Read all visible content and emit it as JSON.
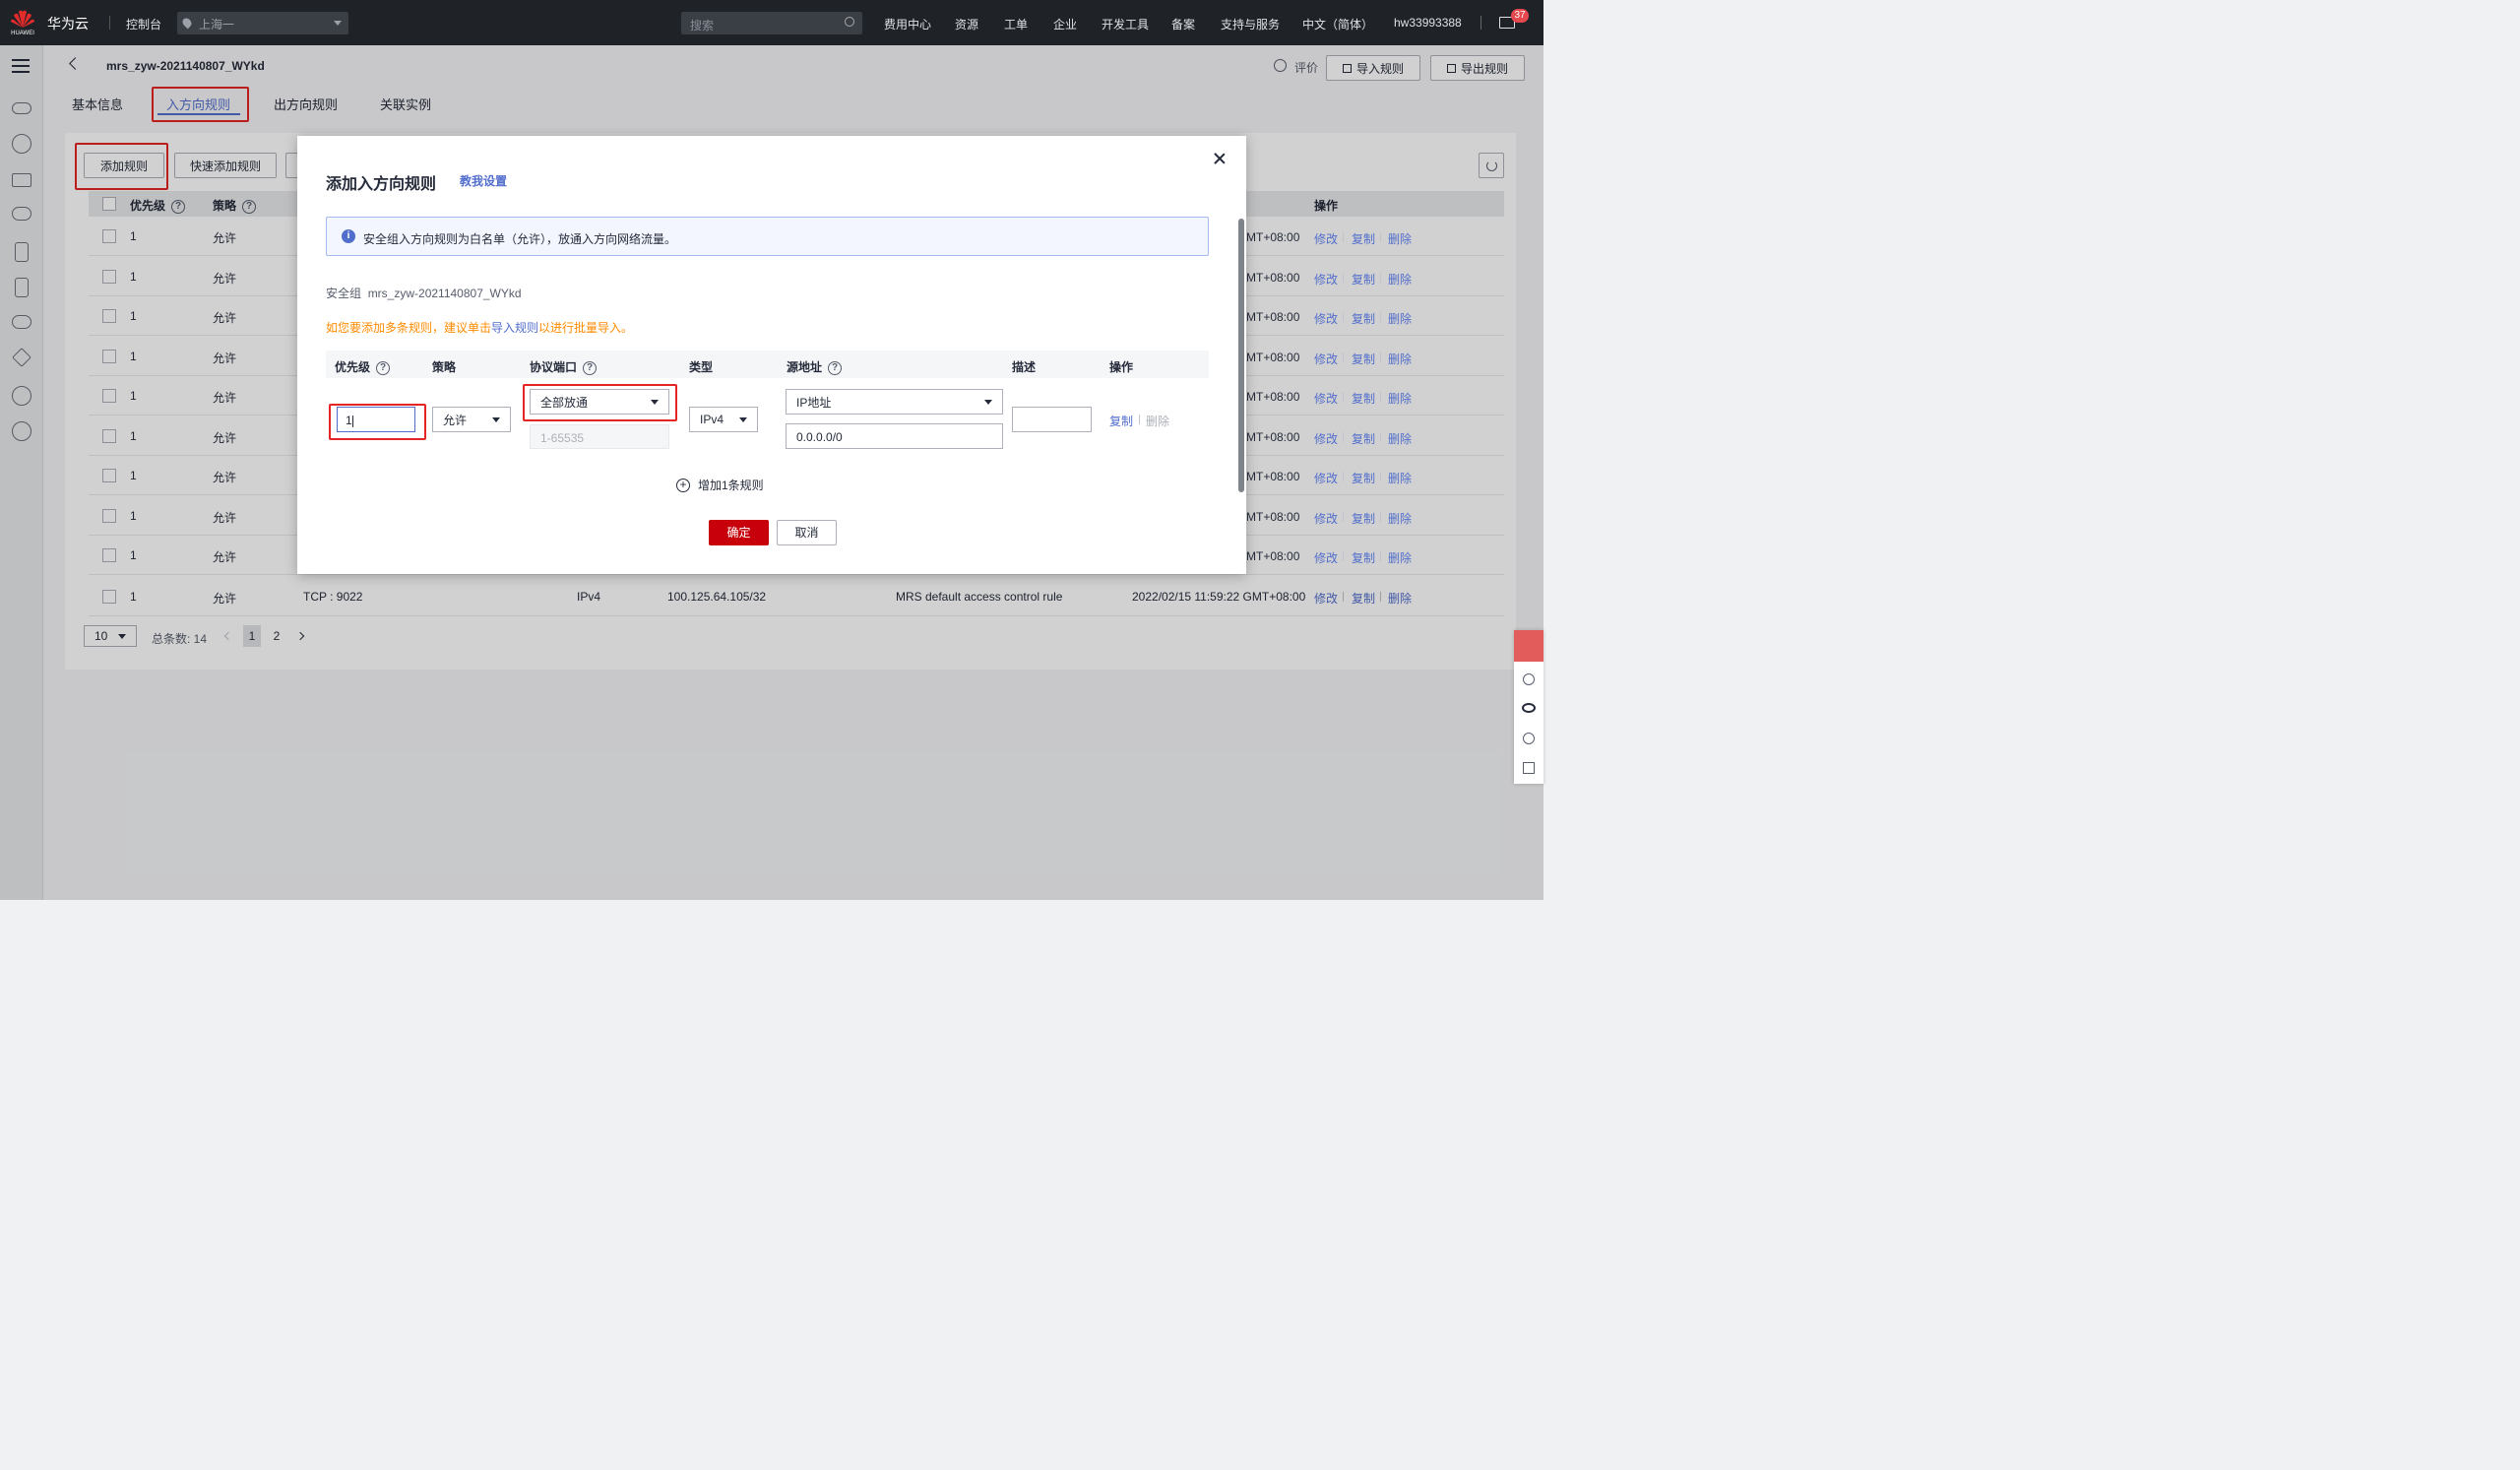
{
  "topnav": {
    "brand": "华为云",
    "logo_text": "HUAWEI",
    "console": "控制台",
    "region": "上海一",
    "search_placeholder": "搜索",
    "menu": [
      "费用中心",
      "资源",
      "工单",
      "企业",
      "开发工具",
      "备案",
      "支持与服务",
      "中文（简体）"
    ],
    "user": "hw33993388",
    "mail_badge": "37"
  },
  "page": {
    "back_title": "mrs_zyw-2021140807_WYkd",
    "feedback": "评价",
    "import_btn": "导入规则",
    "export_btn": "导出规则",
    "tabs": [
      "基本信息",
      "入方向规则",
      "出方向规则",
      "关联实例"
    ],
    "add_rule": "添加规则",
    "quick_add": "快速添加规则"
  },
  "table": {
    "headers": {
      "priority": "优先级",
      "strategy": "策略",
      "operation": "操作"
    },
    "row_priority": "1",
    "row_strategy": "允许",
    "row_time_suffix": "MT+08:00",
    "actions": [
      "修改",
      "复制",
      "删除"
    ],
    "last_row": {
      "priority": "1",
      "strategy": "允许",
      "port": "TCP : 9022",
      "type": "IPv4",
      "source": "100.125.64.105/32",
      "desc": "MRS default access control rule",
      "time": "2022/02/15 11:59:22 GMT+08:00"
    },
    "row_count": 10
  },
  "pager": {
    "size": "10",
    "total": "总条数: 14",
    "pages": [
      "1",
      "2"
    ]
  },
  "dialog": {
    "title": "添加入方向规则",
    "help_link": "教我设置",
    "info": "安全组入方向规则为白名单（允许），放通入方向网络流量。",
    "sg_label": "安全组",
    "sg_name": "mrs_zyw-2021140807_WYkd",
    "hint_prefix": "如您要添加多条规则，建议单击",
    "hint_link": "导入规则",
    "hint_suffix": "以进行批量导入。",
    "cols": {
      "priority": "优先级",
      "strategy": "策略",
      "port": "协议端口",
      "type": "类型",
      "source": "源地址",
      "desc": "描述",
      "op": "操作"
    },
    "priority_value": "1",
    "strategy_value": "允许",
    "port_value": "全部放通",
    "port_range_placeholder": "1-65535",
    "type_value": "IPv4",
    "source_type": "IP地址",
    "source_value": "0.0.0.0/0",
    "op_copy": "复制",
    "op_delete": "删除",
    "add_one": "增加1条规则",
    "confirm": "确定",
    "cancel": "取消"
  }
}
